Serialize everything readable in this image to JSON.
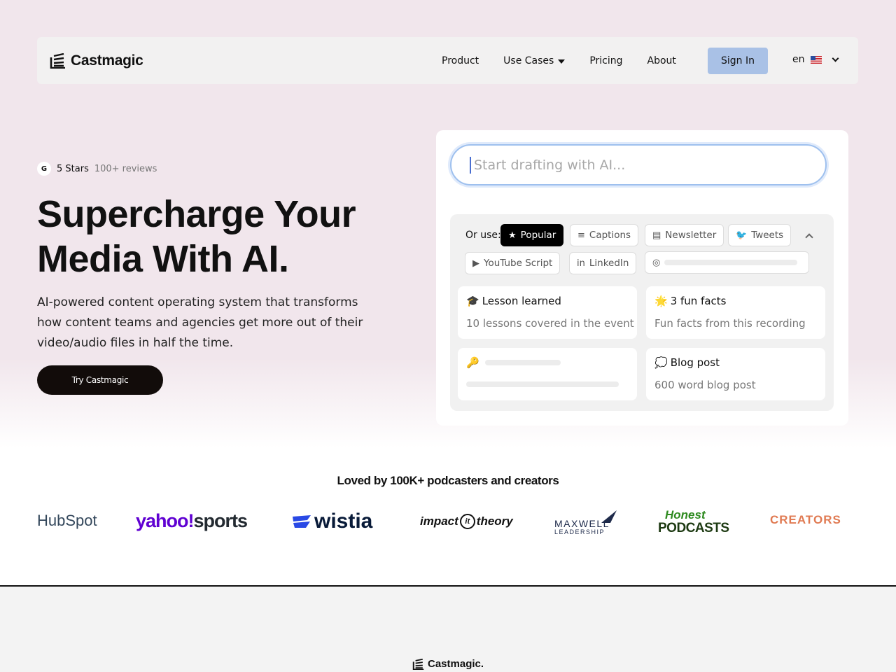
{
  "nav": {
    "logo": "Castmagic",
    "links": [
      "Product",
      "Use Cases",
      "Pricing",
      "About"
    ],
    "signin": "Sign In",
    "lang": "en"
  },
  "hero": {
    "rating_badge": "G",
    "stars": "5 Stars",
    "reviews": "100+ reviews",
    "headline_1": "Supercharge Your",
    "headline_2": "Media With AI.",
    "sub": "AI-powered content operating system that transforms how content teams and agencies get more out of their video/audio files in half the time.",
    "cta": "Try Castmagic"
  },
  "card": {
    "placeholder": "Start drafting with AI...",
    "or_use": "Or use:",
    "chips": [
      "Popular",
      "Captions",
      "Newsletter",
      "Tweets",
      "YouTube Script",
      "LinkedIn"
    ],
    "templates": [
      {
        "icon": "🎓",
        "title": "Lesson learned",
        "desc": "10 lessons covered in the event"
      },
      {
        "icon": "🌟",
        "title": "3 fun facts",
        "desc": "Fun facts from this recording"
      },
      {
        "icon": "🔑",
        "title": "",
        "desc": ""
      },
      {
        "icon": "💭",
        "title": "Blog post",
        "desc": "600 word blog post"
      }
    ]
  },
  "logos": {
    "title": "Loved by 100K+ podcasters and creators",
    "brands": {
      "hubspot": "HubSpot",
      "yahoo": "yahoo!",
      "yahoo_sports": "sports",
      "wistia": "wistia",
      "impact_1": "impact",
      "impact_mark": "it",
      "impact_2": "theory",
      "maxwell_1": "MAXWELL",
      "maxwell_2": "LEADERSHIP",
      "honest_1": "Honest",
      "honest_2": "PODCASTS",
      "creators": "CREATORS"
    }
  },
  "footer": {
    "logo": "Castmagic."
  },
  "colors": {
    "hero_bg": "#f1e6ec",
    "signin_bg": "#a9c1e6",
    "cta_bg": "#120c0a",
    "yahoo": "#6001d2",
    "wistia": "#2949e5",
    "honest": "#2e8a1f",
    "creators": "#e07a52"
  }
}
